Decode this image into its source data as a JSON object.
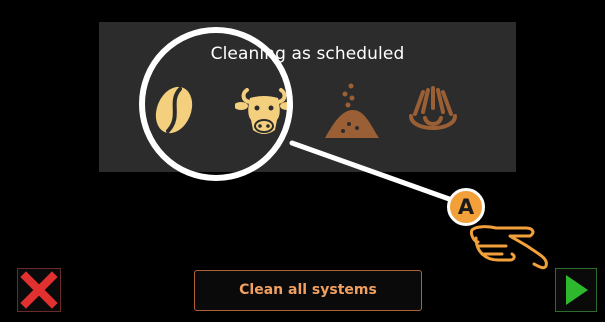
{
  "panel": {
    "title": "Cleaning as scheduled",
    "icons": [
      {
        "name": "coffee-bean-icon",
        "color": "#f3cf7e",
        "active": true
      },
      {
        "name": "cow-icon",
        "color": "#f3cf7e",
        "active": true
      },
      {
        "name": "powder-icon",
        "color": "#9a5f35",
        "active": false
      },
      {
        "name": "milk-frother-icon",
        "color": "#9a5f35",
        "active": false
      }
    ],
    "background": "#2c2c2c"
  },
  "annotation": {
    "badge_label": "A",
    "badge_color": "#f2a03a",
    "hand_color": "#f2a03a"
  },
  "footer": {
    "cancel_icon": "close-icon",
    "cancel_color": "#e0302f",
    "clean_all_label": "Clean all systems",
    "clean_all_color": "#f0a060",
    "next_icon": "play-icon",
    "next_color": "#2db82d"
  }
}
